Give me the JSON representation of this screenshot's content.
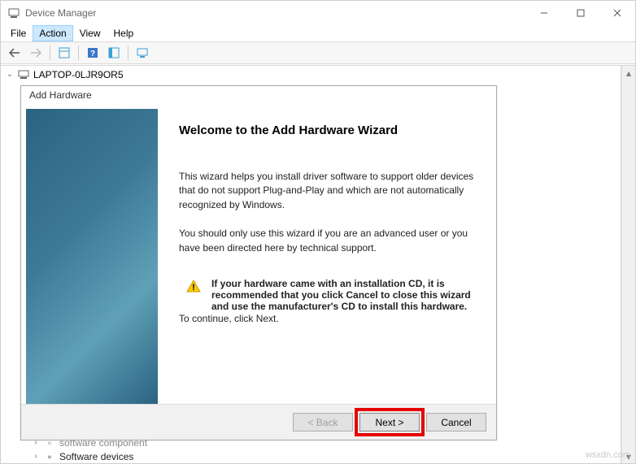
{
  "window": {
    "title": "Device Manager"
  },
  "menu": {
    "file": "File",
    "action": "Action",
    "view": "View",
    "help": "Help"
  },
  "tree": {
    "root": "LAPTOP-0LJR9OR5",
    "child1": "software component",
    "child2": "Software devices"
  },
  "wizard": {
    "title": "Add Hardware",
    "heading": "Welcome to the Add Hardware Wizard",
    "para1": "This wizard helps you install driver software to support older devices that do not support Plug-and-Play and which are not automatically recognized by Windows.",
    "para2": "You should only use this wizard if you are an advanced user or you have been directed here by technical support.",
    "warn": "If your hardware came with an installation CD, it is recommended that you click Cancel to close this wizard and use the manufacturer's CD to install this hardware.",
    "continue": "To continue, click Next.",
    "back": "< Back",
    "next": "Next >",
    "cancel": "Cancel"
  },
  "watermark": "wsxdn.com"
}
